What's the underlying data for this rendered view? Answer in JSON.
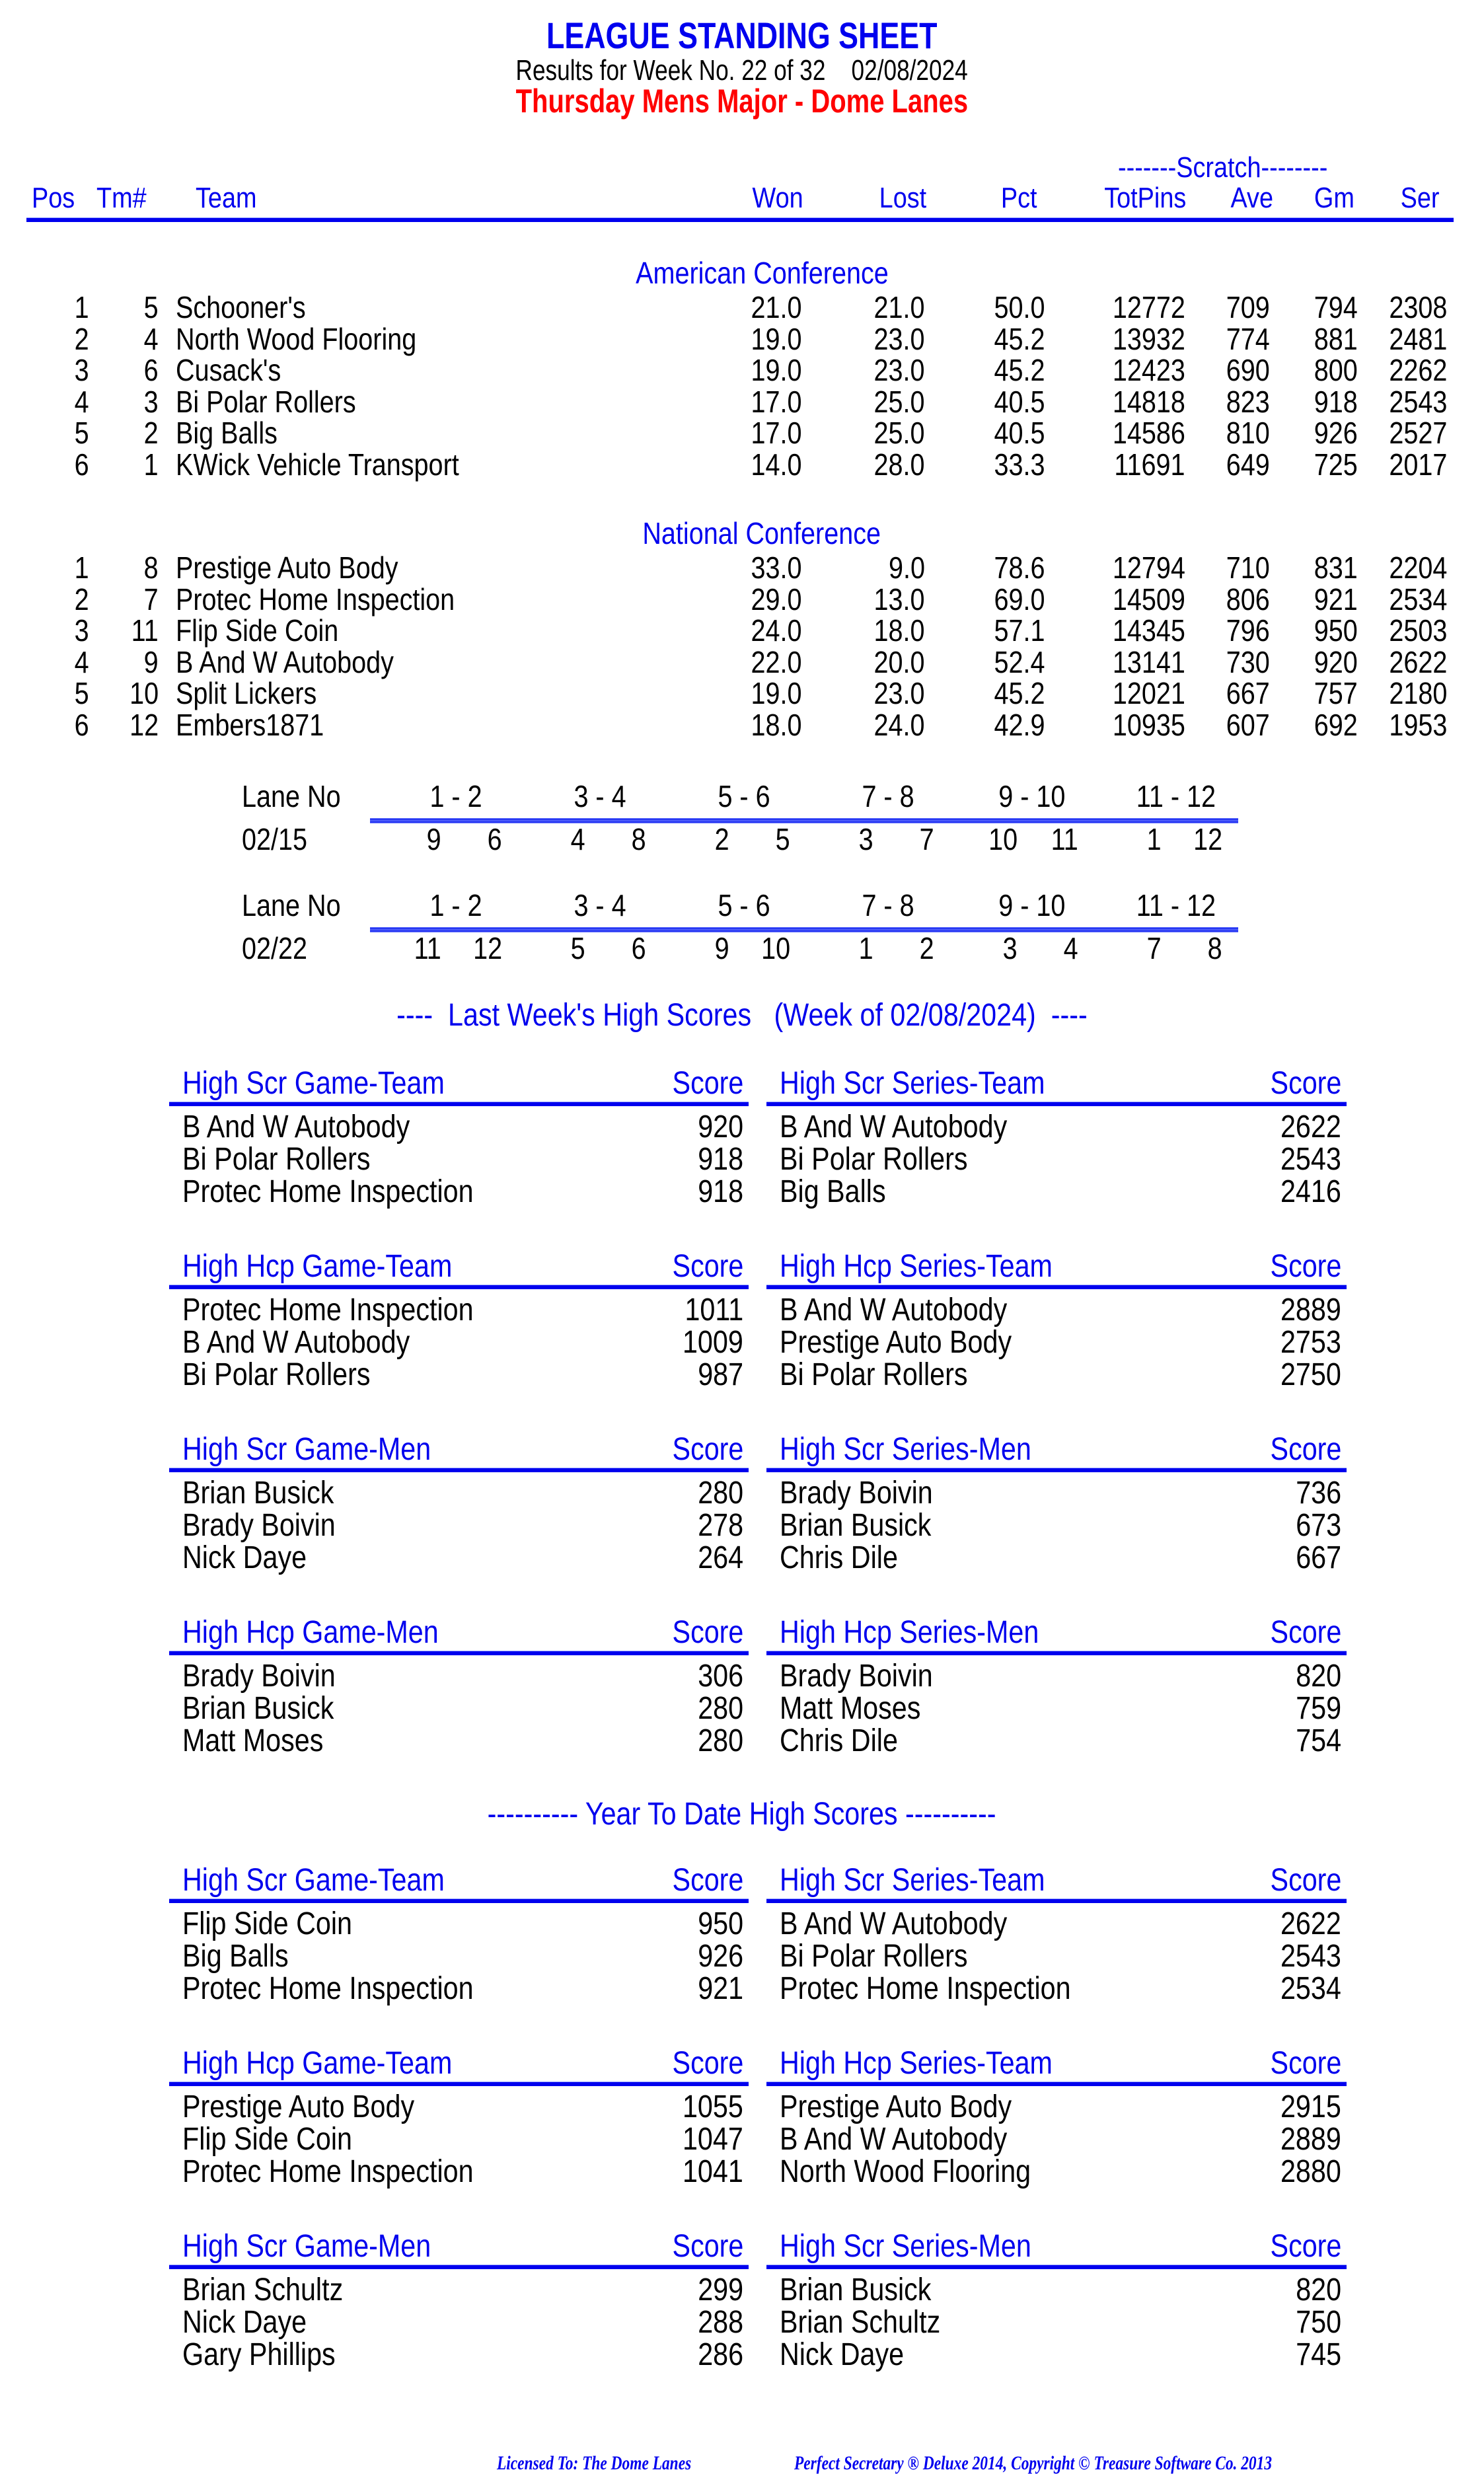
{
  "header": {
    "title": "LEAGUE STANDING SHEET",
    "subtitle": "Results for Week No. 22 of 32    02/08/2024",
    "league_name": "Thursday Mens Major - Dome Lanes"
  },
  "standings": {
    "group_label": "-------Scratch--------",
    "columns": [
      "Pos",
      "Tm#",
      "Team",
      "Won",
      "Lost",
      "Pct",
      "TotPins",
      "Ave",
      "Gm",
      "Ser"
    ],
    "conferences": [
      {
        "name": "American Conference",
        "rows": [
          {
            "pos": "1",
            "tm": "5",
            "team": "Schooner's",
            "won": "21.0",
            "lost": "21.0",
            "pct": "50.0",
            "totpins": "12772",
            "ave": "709",
            "gm": "794",
            "ser": "2308"
          },
          {
            "pos": "2",
            "tm": "4",
            "team": "North Wood Flooring",
            "won": "19.0",
            "lost": "23.0",
            "pct": "45.2",
            "totpins": "13932",
            "ave": "774",
            "gm": "881",
            "ser": "2481"
          },
          {
            "pos": "3",
            "tm": "6",
            "team": "Cusack's",
            "won": "19.0",
            "lost": "23.0",
            "pct": "45.2",
            "totpins": "12423",
            "ave": "690",
            "gm": "800",
            "ser": "2262"
          },
          {
            "pos": "4",
            "tm": "3",
            "team": "Bi Polar Rollers",
            "won": "17.0",
            "lost": "25.0",
            "pct": "40.5",
            "totpins": "14818",
            "ave": "823",
            "gm": "918",
            "ser": "2543"
          },
          {
            "pos": "5",
            "tm": "2",
            "team": "Big Balls",
            "won": "17.0",
            "lost": "25.0",
            "pct": "40.5",
            "totpins": "14586",
            "ave": "810",
            "gm": "926",
            "ser": "2527"
          },
          {
            "pos": "6",
            "tm": "1",
            "team": "KWick Vehicle Transport",
            "won": "14.0",
            "lost": "28.0",
            "pct": "33.3",
            "totpins": "11691",
            "ave": "649",
            "gm": "725",
            "ser": "2017"
          }
        ]
      },
      {
        "name": "National Conference",
        "rows": [
          {
            "pos": "1",
            "tm": "8",
            "team": "Prestige Auto Body",
            "won": "33.0",
            "lost": "9.0",
            "pct": "78.6",
            "totpins": "12794",
            "ave": "710",
            "gm": "831",
            "ser": "2204"
          },
          {
            "pos": "2",
            "tm": "7",
            "team": "Protec Home Inspection",
            "won": "29.0",
            "lost": "13.0",
            "pct": "69.0",
            "totpins": "14509",
            "ave": "806",
            "gm": "921",
            "ser": "2534"
          },
          {
            "pos": "3",
            "tm": "11",
            "team": "Flip Side Coin",
            "won": "24.0",
            "lost": "18.0",
            "pct": "57.1",
            "totpins": "14345",
            "ave": "796",
            "gm": "950",
            "ser": "2503"
          },
          {
            "pos": "4",
            "tm": "9",
            "team": "B And W Autobody",
            "won": "22.0",
            "lost": "20.0",
            "pct": "52.4",
            "totpins": "13141",
            "ave": "730",
            "gm": "920",
            "ser": "2622"
          },
          {
            "pos": "5",
            "tm": "10",
            "team": "Split Lickers",
            "won": "19.0",
            "lost": "23.0",
            "pct": "45.2",
            "totpins": "12021",
            "ave": "667",
            "gm": "757",
            "ser": "2180"
          },
          {
            "pos": "6",
            "tm": "12",
            "team": "Embers1871",
            "won": "18.0",
            "lost": "24.0",
            "pct": "42.9",
            "totpins": "10935",
            "ave": "607",
            "gm": "692",
            "ser": "1953"
          }
        ]
      }
    ]
  },
  "lane_assignments": [
    {
      "label": "Lane No",
      "date": "02/15",
      "pairs": [
        {
          "lanes": "1 - 2",
          "teams": [
            "9",
            "6"
          ]
        },
        {
          "lanes": "3 - 4",
          "teams": [
            "4",
            "8"
          ]
        },
        {
          "lanes": "5 - 6",
          "teams": [
            "2",
            "5"
          ]
        },
        {
          "lanes": "7 - 8",
          "teams": [
            "3",
            "7"
          ]
        },
        {
          "lanes": "9 - 10",
          "teams": [
            "10",
            "11"
          ]
        },
        {
          "lanes": "11 - 12",
          "teams": [
            "1",
            "12"
          ]
        }
      ]
    },
    {
      "label": "Lane No",
      "date": "02/22",
      "pairs": [
        {
          "lanes": "1 - 2",
          "teams": [
            "11",
            "12"
          ]
        },
        {
          "lanes": "3 - 4",
          "teams": [
            "5",
            "6"
          ]
        },
        {
          "lanes": "5 - 6",
          "teams": [
            "9",
            "10"
          ]
        },
        {
          "lanes": "7 - 8",
          "teams": [
            "1",
            "2"
          ]
        },
        {
          "lanes": "9 - 10",
          "teams": [
            "3",
            "4"
          ]
        },
        {
          "lanes": "11 - 12",
          "teams": [
            "7",
            "8"
          ]
        }
      ]
    }
  ],
  "last_week": {
    "title": "----  Last Week's High Scores   (Week of 02/08/2024)  ----",
    "blocks": [
      {
        "left": {
          "title": "High Scr Game-Team",
          "score_label": "Score",
          "entries": [
            [
              "B And W Autobody",
              "920"
            ],
            [
              "Bi Polar Rollers",
              "918"
            ],
            [
              "Protec Home Inspection",
              "918"
            ]
          ]
        },
        "right": {
          "title": "High Scr Series-Team",
          "score_label": "Score",
          "entries": [
            [
              "B And W Autobody",
              "2622"
            ],
            [
              "Bi Polar Rollers",
              "2543"
            ],
            [
              "Big Balls",
              "2416"
            ]
          ]
        }
      },
      {
        "left": {
          "title": "High Hcp Game-Team",
          "score_label": "Score",
          "entries": [
            [
              "Protec Home Inspection",
              "1011"
            ],
            [
              "B And W Autobody",
              "1009"
            ],
            [
              "Bi Polar Rollers",
              "987"
            ]
          ]
        },
        "right": {
          "title": "High Hcp Series-Team",
          "score_label": "Score",
          "entries": [
            [
              "B And W Autobody",
              "2889"
            ],
            [
              "Prestige Auto Body",
              "2753"
            ],
            [
              "Bi Polar Rollers",
              "2750"
            ]
          ]
        }
      },
      {
        "left": {
          "title": "High Scr Game-Men",
          "score_label": "Score",
          "entries": [
            [
              "Brian Busick",
              "280"
            ],
            [
              "Brady Boivin",
              "278"
            ],
            [
              "Nick Daye",
              "264"
            ]
          ]
        },
        "right": {
          "title": "High Scr Series-Men",
          "score_label": "Score",
          "entries": [
            [
              "Brady Boivin",
              "736"
            ],
            [
              "Brian Busick",
              "673"
            ],
            [
              "Chris Dile",
              "667"
            ]
          ]
        }
      },
      {
        "left": {
          "title": "High Hcp Game-Men",
          "score_label": "Score",
          "entries": [
            [
              "Brady Boivin",
              "306"
            ],
            [
              "Brian Busick",
              "280"
            ],
            [
              "Matt Moses",
              "280"
            ]
          ]
        },
        "right": {
          "title": "High Hcp Series-Men",
          "score_label": "Score",
          "entries": [
            [
              "Brady Boivin",
              "820"
            ],
            [
              "Matt Moses",
              "759"
            ],
            [
              "Chris Dile",
              "754"
            ]
          ]
        }
      }
    ]
  },
  "year_to_date": {
    "title": "---------- Year To Date High Scores ----------",
    "blocks": [
      {
        "left": {
          "title": "High Scr Game-Team",
          "score_label": "Score",
          "entries": [
            [
              "Flip Side Coin",
              "950"
            ],
            [
              "Big Balls",
              "926"
            ],
            [
              "Protec Home Inspection",
              "921"
            ]
          ]
        },
        "right": {
          "title": "High Scr Series-Team",
          "score_label": "Score",
          "entries": [
            [
              "B And W Autobody",
              "2622"
            ],
            [
              "Bi Polar Rollers",
              "2543"
            ],
            [
              "Protec Home Inspection",
              "2534"
            ]
          ]
        }
      },
      {
        "left": {
          "title": "High Hcp Game-Team",
          "score_label": "Score",
          "entries": [
            [
              "Prestige Auto Body",
              "1055"
            ],
            [
              "Flip Side Coin",
              "1047"
            ],
            [
              "Protec Home Inspection",
              "1041"
            ]
          ]
        },
        "right": {
          "title": "High Hcp Series-Team",
          "score_label": "Score",
          "entries": [
            [
              "Prestige Auto Body",
              "2915"
            ],
            [
              "B And W Autobody",
              "2889"
            ],
            [
              "North Wood Flooring",
              "2880"
            ]
          ]
        }
      },
      {
        "left": {
          "title": "High Scr Game-Men",
          "score_label": "Score",
          "entries": [
            [
              "Brian Schultz",
              "299"
            ],
            [
              "Nick Daye",
              "288"
            ],
            [
              "Gary Phillips",
              "286"
            ]
          ]
        },
        "right": {
          "title": "High Scr Series-Men",
          "score_label": "Score",
          "entries": [
            [
              "Brian Busick",
              "820"
            ],
            [
              "Brian Schultz",
              "750"
            ],
            [
              "Nick Daye",
              "745"
            ]
          ]
        }
      }
    ]
  },
  "footer": {
    "license": "Licensed To: The Dome Lanes",
    "software": "Perfect Secretary ® Deluxe  2014, Copyright © Treasure Software Co. 2013"
  },
  "colors": {
    "heading_blue": "#0000ee",
    "league_red": "#ff0000",
    "text": "#000000"
  }
}
